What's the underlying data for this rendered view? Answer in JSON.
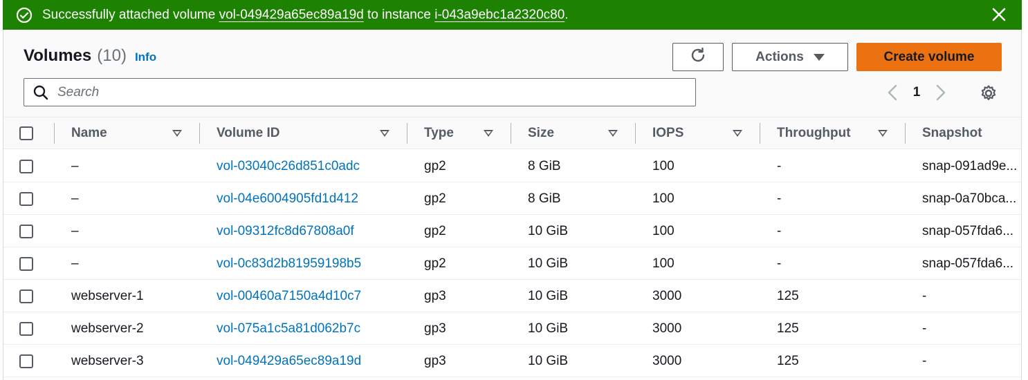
{
  "flash": {
    "prefix": "Successfully attached volume ",
    "volume_link": "vol-049429a65ec89a19d",
    "middle": " to instance ",
    "instance_link": "i-043a9ebc1a2320c80",
    "suffix": ".",
    "icon": "check-circle-icon",
    "close_icon": "close-icon",
    "color": "#1d8102"
  },
  "header": {
    "title": "Volumes",
    "count": "(10)",
    "info": "Info",
    "actions_label": "Actions",
    "create_label": "Create volume",
    "accent": "#ec7211"
  },
  "search": {
    "placeholder": "Search"
  },
  "pagination": {
    "current": "1"
  },
  "table": {
    "columns": [
      "Name",
      "Volume ID",
      "Type",
      "Size",
      "IOPS",
      "Throughput",
      "Snapshot"
    ],
    "rows": [
      {
        "name": "–",
        "volume_id": "vol-03040c26d851c0adc",
        "type": "gp2",
        "size": "8 GiB",
        "iops": "100",
        "throughput": "-",
        "snapshot": "snap-091ad9e..."
      },
      {
        "name": "–",
        "volume_id": "vol-04e6004905fd1d412",
        "type": "gp2",
        "size": "8 GiB",
        "iops": "100",
        "throughput": "-",
        "snapshot": "snap-0a70bca..."
      },
      {
        "name": "–",
        "volume_id": "vol-09312fc8d67808a0f",
        "type": "gp2",
        "size": "10 GiB",
        "iops": "100",
        "throughput": "-",
        "snapshot": "snap-057fda6..."
      },
      {
        "name": "–",
        "volume_id": "vol-0c83d2b81959198b5",
        "type": "gp2",
        "size": "10 GiB",
        "iops": "100",
        "throughput": "-",
        "snapshot": "snap-057fda6..."
      },
      {
        "name": "webserver-1",
        "volume_id": "vol-00460a7150a4d10c7",
        "type": "gp3",
        "size": "10 GiB",
        "iops": "3000",
        "throughput": "125",
        "snapshot": "-"
      },
      {
        "name": "webserver-2",
        "volume_id": "vol-075a1c5a81d062b7c",
        "type": "gp3",
        "size": "10 GiB",
        "iops": "3000",
        "throughput": "125",
        "snapshot": "-"
      },
      {
        "name": "webserver-3",
        "volume_id": "vol-049429a65ec89a19d",
        "type": "gp3",
        "size": "10 GiB",
        "iops": "3000",
        "throughput": "125",
        "snapshot": "-"
      }
    ]
  }
}
